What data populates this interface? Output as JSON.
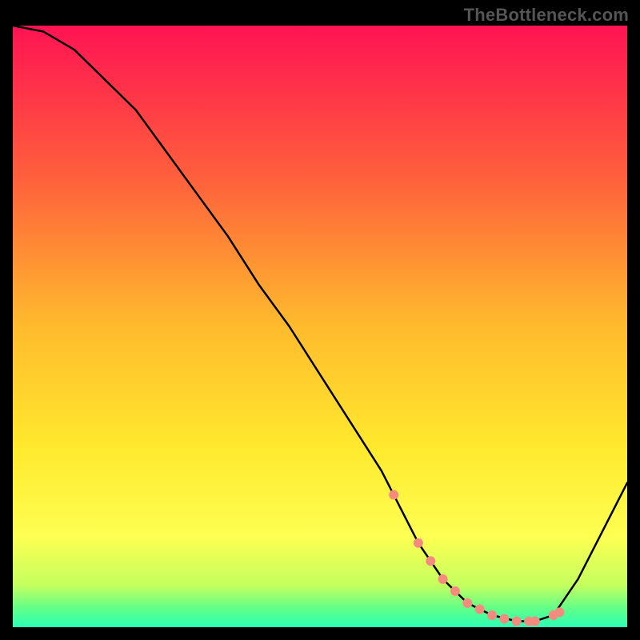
{
  "watermark": "TheBottleneck.com",
  "chart_data": {
    "type": "line",
    "title": "",
    "xlabel": "",
    "ylabel": "",
    "xlim": [
      0,
      100
    ],
    "ylim": [
      0,
      100
    ],
    "series": [
      {
        "name": "bottleneck-curve",
        "x": [
          0,
          5,
          10,
          15,
          20,
          25,
          30,
          35,
          40,
          45,
          50,
          55,
          60,
          62,
          66,
          70,
          74,
          78,
          82,
          85,
          88,
          92,
          96,
          100
        ],
        "values": [
          100,
          99,
          96,
          91,
          86,
          79,
          72,
          65,
          57,
          50,
          42,
          34,
          26,
          22,
          14,
          8,
          4,
          2,
          1,
          1,
          2,
          8,
          16,
          24
        ]
      }
    ],
    "highlight_points": {
      "name": "marker-dots",
      "color": "#f58b7f",
      "x": [
        62,
        66,
        68,
        70,
        72,
        74,
        76,
        78,
        80,
        82,
        84,
        85,
        88,
        89
      ],
      "values": [
        22,
        14,
        11,
        8,
        6,
        4,
        3,
        2,
        1.4,
        1,
        1,
        1,
        2,
        2.5
      ]
    },
    "background_gradient": {
      "stops": [
        {
          "pos": 0.0,
          "color": "#ff1353"
        },
        {
          "pos": 0.25,
          "color": "#ff5f3c"
        },
        {
          "pos": 0.5,
          "color": "#ffbb2d"
        },
        {
          "pos": 0.7,
          "color": "#ffe92d"
        },
        {
          "pos": 0.85,
          "color": "#fdff52"
        },
        {
          "pos": 0.93,
          "color": "#c4ff5e"
        },
        {
          "pos": 0.97,
          "color": "#5fff8a"
        },
        {
          "pos": 1.0,
          "color": "#2affb6"
        }
      ]
    }
  }
}
